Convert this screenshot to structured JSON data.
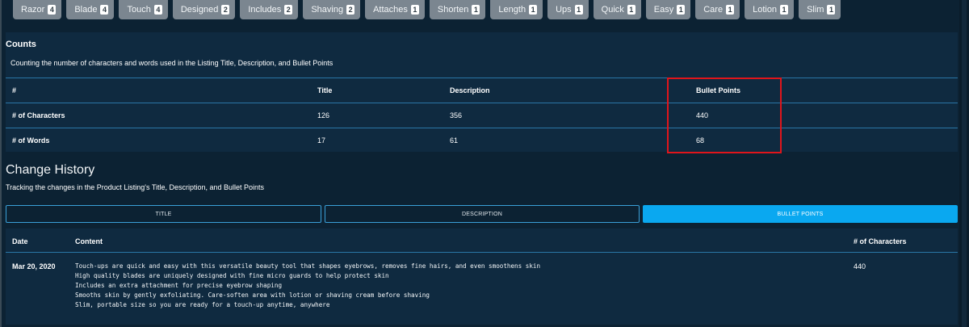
{
  "keywords": [
    {
      "word": "Razor",
      "count": "4"
    },
    {
      "word": "Blade",
      "count": "4"
    },
    {
      "word": "Touch",
      "count": "4"
    },
    {
      "word": "Designed",
      "count": "2"
    },
    {
      "word": "Includes",
      "count": "2"
    },
    {
      "word": "Shaving",
      "count": "2"
    },
    {
      "word": "Attaches",
      "count": "1"
    },
    {
      "word": "Shorten",
      "count": "1"
    },
    {
      "word": "Length",
      "count": "1"
    },
    {
      "word": "Ups",
      "count": "1"
    },
    {
      "word": "Quick",
      "count": "1"
    },
    {
      "word": "Easy",
      "count": "1"
    },
    {
      "word": "Care",
      "count": "1"
    },
    {
      "word": "Lotion",
      "count": "1"
    },
    {
      "word": "Slim",
      "count": "1"
    }
  ],
  "counts": {
    "title": "Counts",
    "description": "Counting the number of characters and words used in the Listing Title, Description, and Bullet Points",
    "headers": [
      "#",
      "Title",
      "Description",
      "Bullet Points"
    ],
    "rows": [
      [
        "# of Characters",
        "126",
        "356",
        "440"
      ],
      [
        "# of Words",
        "17",
        "61",
        "68"
      ]
    ]
  },
  "history": {
    "title": "Change History",
    "description": "Tracking the changes in the Product Listing's Title, Description, and Bullet Points",
    "tabs": [
      "TITLE",
      "DESCRIPTION",
      "BULLET POINTS"
    ],
    "active_tab": "BULLET POINTS",
    "headers": [
      "Date",
      "Content",
      "# of Characters"
    ],
    "rows": [
      {
        "date": "Mar 20, 2020",
        "lines": [
          "Touch-ups are quick and easy with this versatile beauty tool that shapes eyebrows, removes fine hairs, and even smoothens skin",
          "High quality blades are uniquely designed with fine micro guards to help protect skin",
          "Includes an extra attachment for precise eyebrow shaping",
          "Smooths skin by gently exfoliating. Care-soften area with lotion or shaving cream before shaving",
          "Slim, portable size so you are ready for a touch-up anytime, anywhere"
        ],
        "chars": "440"
      }
    ]
  },
  "colors": {
    "background": "#0c2233",
    "card": "#0f2a40",
    "chip": "#7b8690",
    "row_border": "#2a76a6",
    "active_tab": "#0aa8f0",
    "highlight": "#e0151b"
  }
}
